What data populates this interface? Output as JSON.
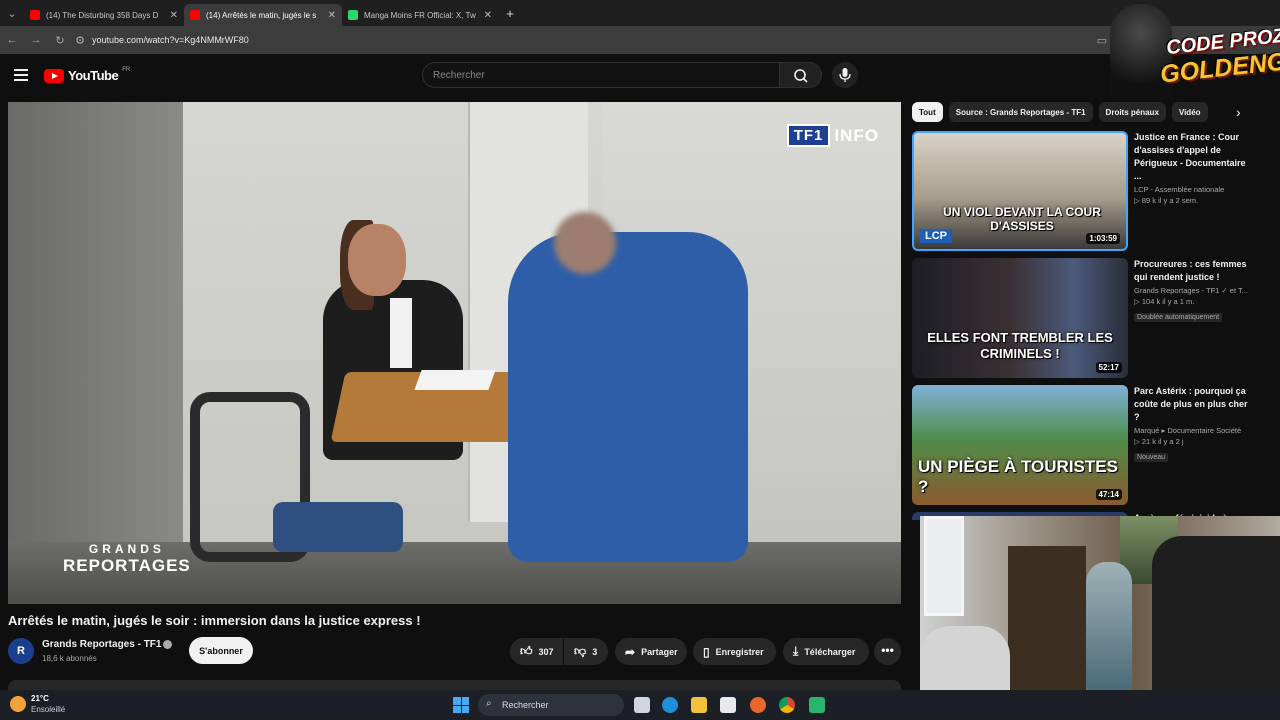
{
  "browser": {
    "tabs": [
      {
        "title": "(14) The Disturbing 358 Days D",
        "favicon_color": "#ff0000",
        "active": false
      },
      {
        "title": "(14) Arrêtés le matin, jugés le s",
        "favicon_color": "#ff0000",
        "active": true
      },
      {
        "title": "Manga Moins FR Official: X, Tw",
        "favicon_color": "#2bd66b",
        "active": false
      }
    ],
    "new_tab": "+",
    "url": "youtube.com/watch?v=Kg4NMMrWF80"
  },
  "header": {
    "logo_text": "YouTube",
    "logo_country": "FR",
    "search_placeholder": "Rechercher"
  },
  "player": {
    "channel_bug": {
      "tf1": "TF1",
      "info": "INFO"
    },
    "show_logo": {
      "line1": "GRANDS",
      "line2": "REPORTAGES"
    }
  },
  "video": {
    "title": "Arrêtés le matin, jugés le soir : immersion dans la justice express !",
    "channel": {
      "name": "Grands Reportages - TF1",
      "subscribers": "18,6 k abonnés",
      "avatar_text": "R"
    },
    "subscribe_label": "S'abonner",
    "likes": "307",
    "dislikes": "3",
    "share_label": "Partager",
    "save_label": "Enregistrer",
    "download_label": "Télécharger",
    "more_label": "•••"
  },
  "chips": [
    "Tout",
    "Source : Grands Reportages - TF1",
    "Droits pénaux",
    "Vidéo"
  ],
  "recommendations": [
    {
      "title": "Justice en France : Cour d'assises d'appel de Périgueux - Documentaire ...",
      "channel": "LCP - Assemblée nationale",
      "stats": "▷ 89 k   il y a 2 sem.",
      "duration": "1:03:59",
      "thumb_caption": "UN VIOL DEVANT LA COUR D'ASSISES",
      "thumb_badge": "LCP",
      "badge": ""
    },
    {
      "title": "Procureures : ces femmes qui rendent justice !",
      "channel": "Grands Reportages - TF1 ✓ et T...",
      "stats": "▷ 104 k   il y a 1 m.",
      "duration": "52:17",
      "thumb_caption": "ELLES FONT TREMBLER LES CRIMINELS !",
      "thumb_badge": "",
      "badge": "Doublée automatiquement"
    },
    {
      "title": "Parc Astérix : pourquoi ça coûte de plus en plus cher ?",
      "channel": "Marqué ▸ Documentaire Société",
      "stats": "▷ 21 k   il y a 2 j",
      "duration": "47:14",
      "thumb_caption": "UN PIÈGE À TOURISTES ?",
      "thumb_badge": "",
      "badge": "Nouveau"
    }
  ],
  "partial_rec_title": "Après un féminicide à",
  "overlay": {
    "line1": "CODE PROZIS",
    "line2": "GOLDENG"
  },
  "taskbar": {
    "temperature": "21°C",
    "weather": "Ensoleillé",
    "search": "Rechercher"
  }
}
